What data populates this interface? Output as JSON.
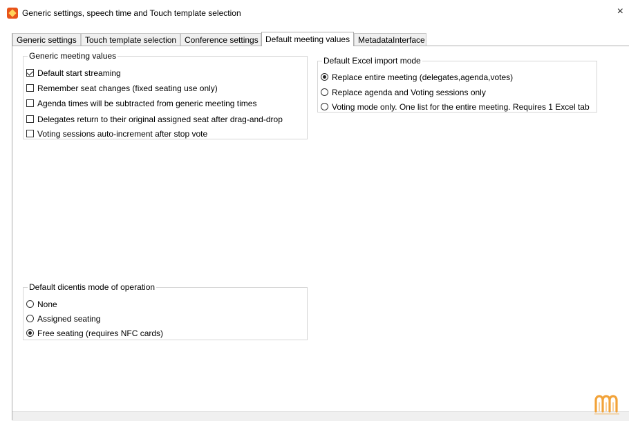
{
  "window": {
    "title": "Generic settings, speech time and Touch template selection",
    "close_symbol": "×"
  },
  "tabs": [
    {
      "label": "Generic settings",
      "active": false
    },
    {
      "label": "Touch template selection",
      "active": false
    },
    {
      "label": "Conference settings",
      "active": false
    },
    {
      "label": "Default meeting values",
      "active": true
    },
    {
      "label": "MetadataInterface",
      "active": false
    }
  ],
  "generic_meeting_values": {
    "title": "Generic meeting values",
    "items": [
      {
        "label": "Default start streaming",
        "checked": true
      },
      {
        "label": "Remember seat changes (fixed seating use only)",
        "checked": false
      },
      {
        "label": "Agenda times will be subtracted from generic meeting times",
        "checked": false
      },
      {
        "label": "Delegates return to their original assigned seat after drag-and-drop",
        "checked": false
      },
      {
        "label": "Voting sessions auto-increment after stop vote",
        "checked": false
      }
    ]
  },
  "default_excel_import_mode": {
    "title": "Default Excel import mode",
    "options": [
      {
        "label": "Replace entire meeting (delegates,agenda,votes)",
        "selected": true
      },
      {
        "label": "Replace agenda and Voting sessions only",
        "selected": false
      },
      {
        "label": "Voting mode only. One list for the entire meeting. Requires 1 Excel tab",
        "selected": false
      }
    ]
  },
  "default_dicentis_mode": {
    "title": "Default dicentis mode of operation",
    "options": [
      {
        "label": "None",
        "selected": false
      },
      {
        "label": "Assigned seating",
        "selected": false
      },
      {
        "label": "Free seating (requires NFC cards)",
        "selected": true
      }
    ]
  },
  "colors": {
    "logo": "#f2a33a",
    "app_icon": "#e8541a"
  }
}
